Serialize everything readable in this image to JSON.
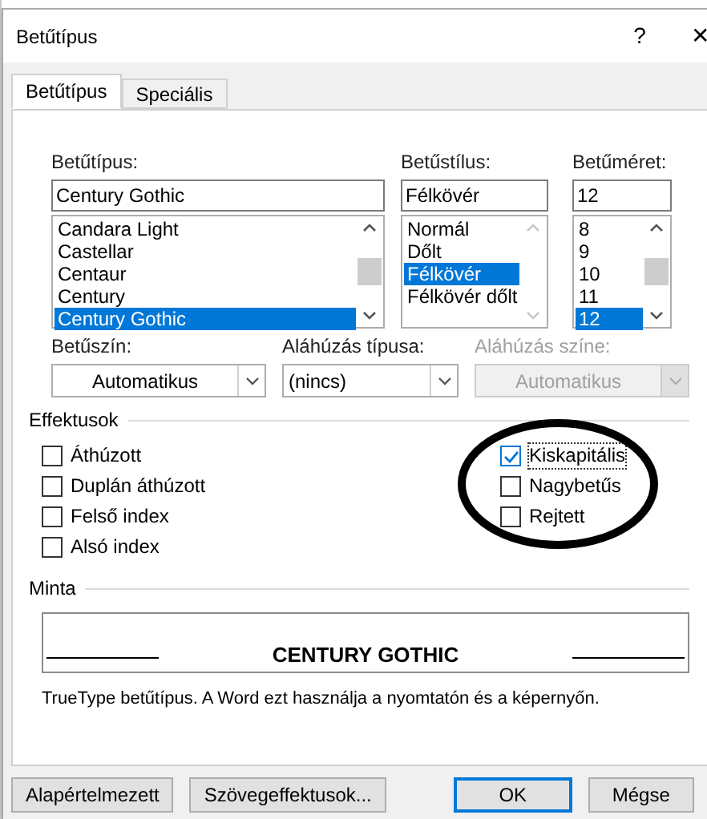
{
  "window": {
    "title": "Betűtípus",
    "help": "?",
    "close": "✕"
  },
  "tabs": [
    {
      "label": "Betűtípus",
      "selected": true
    },
    {
      "label": "Speciális",
      "selected": false
    }
  ],
  "font": {
    "label": "Betűtípus:",
    "value": "Century Gothic",
    "items": [
      {
        "label": "Candara Light",
        "selected": false
      },
      {
        "label": "Castellar",
        "selected": false
      },
      {
        "label": "Centaur",
        "selected": false
      },
      {
        "label": "Century",
        "selected": false
      },
      {
        "label": "Century Gothic",
        "selected": true
      }
    ]
  },
  "style": {
    "label": "Betűstílus:",
    "value": "Félkövér",
    "items": [
      {
        "label": "Normál",
        "selected": false
      },
      {
        "label": "Dőlt",
        "selected": false
      },
      {
        "label": "Félkövér",
        "selected": true
      },
      {
        "label": "Félkövér dőlt",
        "selected": false
      }
    ]
  },
  "size": {
    "label": "Betűméret:",
    "value": "12",
    "items": [
      {
        "label": "8",
        "selected": false
      },
      {
        "label": "9",
        "selected": false
      },
      {
        "label": "10",
        "selected": false
      },
      {
        "label": "11",
        "selected": false
      },
      {
        "label": "12",
        "selected": true
      }
    ]
  },
  "dropdowns": [
    {
      "label": "Betűszín:",
      "value": "Automatikus",
      "disabled": false,
      "centered": true
    },
    {
      "label": "Aláhúzás típusa:",
      "value": "(nincs)",
      "disabled": false,
      "centered": false
    },
    {
      "label": "Aláhúzás színe:",
      "value": "Automatikus",
      "disabled": true,
      "centered": true
    }
  ],
  "effects": {
    "title": "Effektusok",
    "left": [
      {
        "label": "Áthúzott",
        "checked": false
      },
      {
        "label": "Duplán áthúzott",
        "checked": false
      },
      {
        "label": "Felső index",
        "checked": false
      },
      {
        "label": "Alsó index",
        "checked": false
      }
    ],
    "right": [
      {
        "label": "Kiskapitális",
        "checked": true
      },
      {
        "label": "Nagybetűs",
        "checked": false
      },
      {
        "label": "Rejtett",
        "checked": false
      }
    ]
  },
  "preview": {
    "title": "Minta",
    "sample": "CENTURY GOTHIC",
    "description": "TrueType betűtípus. A Word ezt használja a nyomtatón és a képernyőn."
  },
  "buttons": [
    {
      "label": "Alapértelmezett",
      "default": false
    },
    {
      "label": "Szövegeffektusok...",
      "default": false
    },
    {
      "label": "OK",
      "default": true
    },
    {
      "label": "Mégse",
      "default": false
    }
  ]
}
